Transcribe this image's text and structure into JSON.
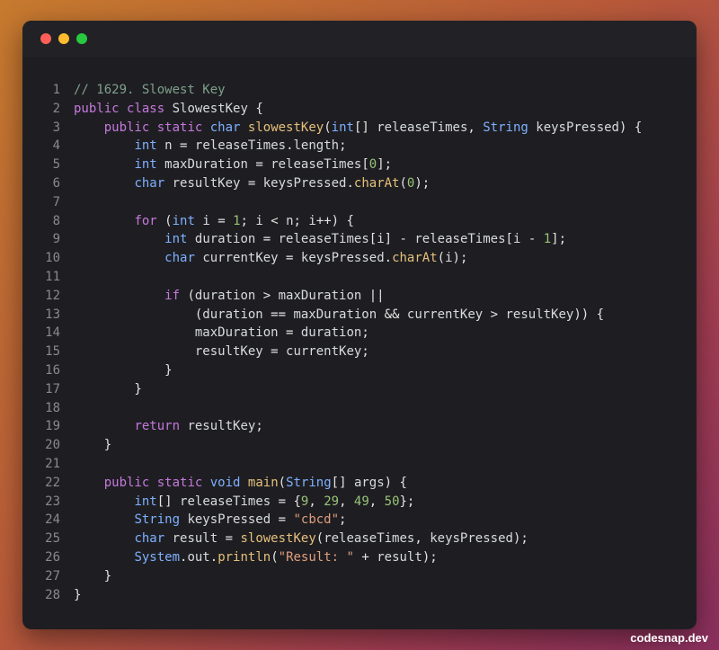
{
  "window": {
    "buttons": {
      "close": "close",
      "minimize": "minimize",
      "zoom": "zoom"
    }
  },
  "code": {
    "language": "java",
    "lines": [
      "// 1629. Slowest Key",
      "public class SlowestKey {",
      "    public static char slowestKey(int[] releaseTimes, String keysPressed) {",
      "        int n = releaseTimes.length;",
      "        int maxDuration = releaseTimes[0];",
      "        char resultKey = keysPressed.charAt(0);",
      "",
      "        for (int i = 1; i < n; i++) {",
      "            int duration = releaseTimes[i] - releaseTimes[i - 1];",
      "            char currentKey = keysPressed.charAt(i);",
      "",
      "            if (duration > maxDuration ||",
      "                (duration == maxDuration && currentKey > resultKey)) {",
      "                maxDuration = duration;",
      "                resultKey = currentKey;",
      "            }",
      "        }",
      "",
      "        return resultKey;",
      "    }",
      "",
      "    public static void main(String[] args) {",
      "        int[] releaseTimes = {9, 29, 49, 50};",
      "        String keysPressed = \"cbcd\";",
      "        char result = slowestKey(releaseTimes, keysPressed);",
      "        System.out.println(\"Result: \" + result);",
      "    }",
      "}"
    ]
  },
  "watermark": "codesnap.dev",
  "colors": {
    "keyword": "#c678dd",
    "type": "#7fb0ff",
    "function": "#e5c07b",
    "comment": "#7ea08a",
    "number": "#98c379",
    "string": "#e09f7d",
    "line_number": "#8a8a8a",
    "editor_bg": "#1e1e22"
  }
}
